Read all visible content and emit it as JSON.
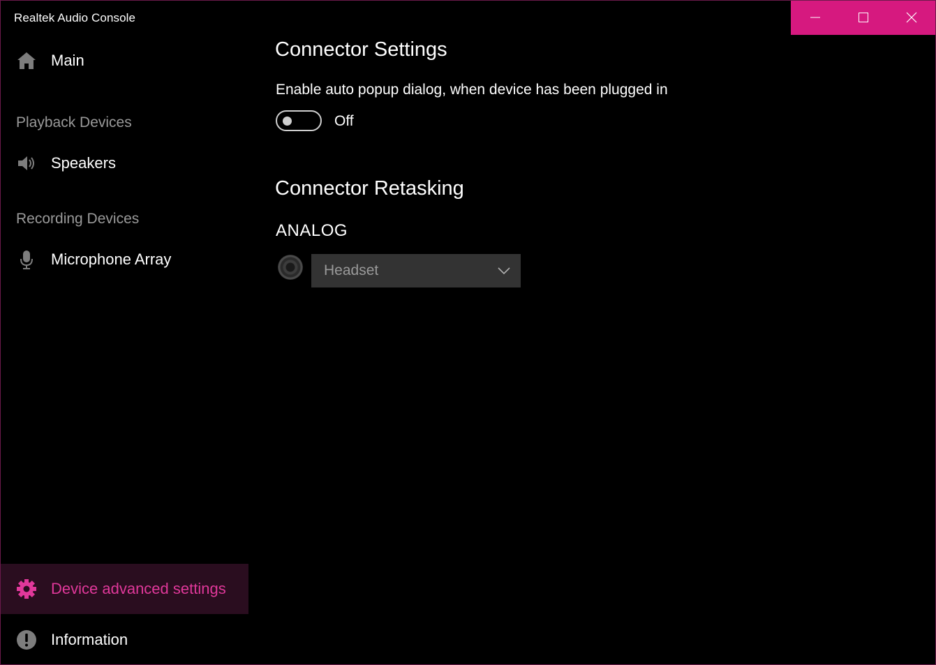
{
  "window": {
    "title": "Realtek Audio Console",
    "accent_color": "#d6197f",
    "minimize_icon": "minimize-icon",
    "maximize_icon": "maximize-icon",
    "close_icon": "close-icon"
  },
  "sidebar": {
    "main": {
      "label": "Main",
      "icon": "home-icon"
    },
    "playback_header": "Playback Devices",
    "speakers": {
      "label": "Speakers",
      "icon": "speaker-icon"
    },
    "recording_header": "Recording Devices",
    "microphone": {
      "label": "Microphone Array",
      "icon": "microphone-icon"
    },
    "advanced": {
      "label": "Device advanced settings",
      "icon": "gear-icon",
      "selected": true
    },
    "information": {
      "label": "Information",
      "icon": "info-icon"
    }
  },
  "content": {
    "connector_settings_title": "Connector Settings",
    "auto_popup_text": "Enable auto popup dialog, when device has been plugged in",
    "auto_popup_state": "Off",
    "connector_retasking_title": "Connector Retasking",
    "analog_label": "ANALOG",
    "jack_icon": "audio-jack-icon",
    "jack_select_value": "Headset"
  }
}
